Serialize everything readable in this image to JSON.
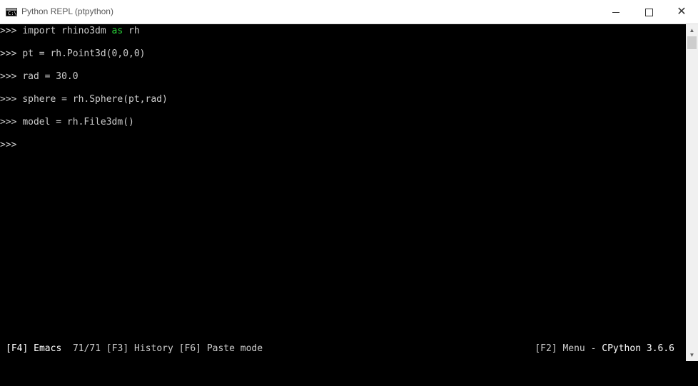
{
  "window": {
    "title": "Python REPL (ptpython)",
    "icon_text": "C:\\"
  },
  "terminal": {
    "lines": [
      {
        "prompt": ">>>",
        "pre": "import rhino3dm ",
        "kw": "as",
        "post": " rh"
      },
      {
        "prompt": ">>>",
        "pre": "pt = rh.Point3d(0,0,0)",
        "kw": "",
        "post": ""
      },
      {
        "prompt": ">>>",
        "pre": "rad = 30.0",
        "kw": "",
        "post": ""
      },
      {
        "prompt": ">>>",
        "pre": "sphere = rh.Sphere(pt,rad)",
        "kw": "",
        "post": ""
      },
      {
        "prompt": ">>>",
        "pre": "model = rh.File3dm()",
        "kw": "",
        "post": ""
      },
      {
        "prompt": ">>>",
        "pre": "",
        "kw": "",
        "post": ""
      }
    ],
    "keyword_color": "#2ad43a"
  },
  "status_bar": {
    "f4_key": "[F4]",
    "f4_label": "Emacs",
    "counter": "71/71",
    "f3_key": "[F3]",
    "f3_label": "History",
    "f6_key": "[F6]",
    "f6_label": "Paste mode",
    "f2_key": "[F2]",
    "f2_label": "Menu -",
    "python_version": "CPython 3.6.6"
  }
}
